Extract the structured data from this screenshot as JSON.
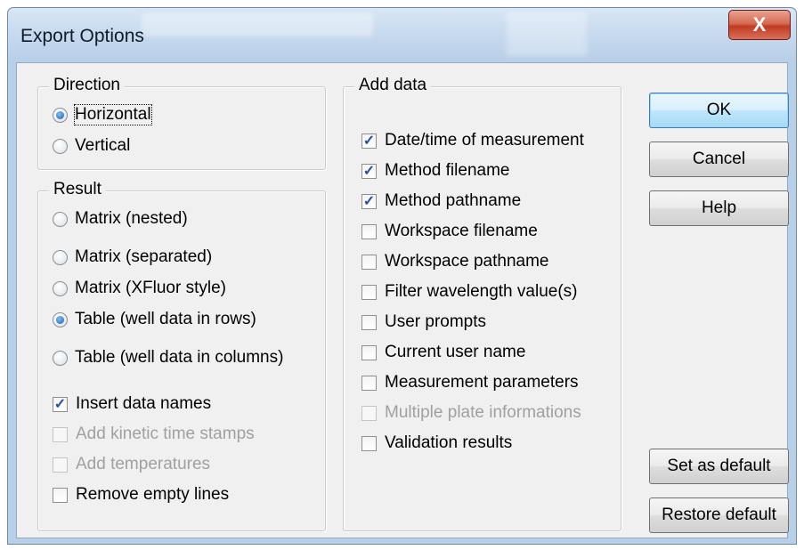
{
  "window": {
    "title": "Export Options",
    "close_label": "X"
  },
  "direction": {
    "legend": "Direction",
    "options": [
      {
        "label": "Horizontal",
        "selected": true
      },
      {
        "label": "Vertical",
        "selected": false
      }
    ]
  },
  "result": {
    "legend": "Result",
    "options": [
      {
        "label": "Matrix (nested)",
        "selected": false
      },
      {
        "label": "Matrix (separated)",
        "selected": false
      },
      {
        "label": "Matrix (XFluor style)",
        "selected": false
      },
      {
        "label": "Table (well data in rows)",
        "selected": true
      },
      {
        "label": "Table (well data in columns)",
        "selected": false
      }
    ],
    "checks": [
      {
        "label": "Insert data names",
        "checked": true,
        "enabled": true
      },
      {
        "label": "Add kinetic time stamps",
        "checked": false,
        "enabled": false
      },
      {
        "label": "Add temperatures",
        "checked": false,
        "enabled": false
      },
      {
        "label": "Remove empty lines",
        "checked": false,
        "enabled": true
      }
    ]
  },
  "add_data": {
    "legend": "Add data",
    "checks": [
      {
        "label": "Date/time of measurement",
        "checked": true,
        "enabled": true
      },
      {
        "label": "Method filename",
        "checked": true,
        "enabled": true
      },
      {
        "label": "Method pathname",
        "checked": true,
        "enabled": true
      },
      {
        "label": "Workspace filename",
        "checked": false,
        "enabled": true
      },
      {
        "label": "Workspace pathname",
        "checked": false,
        "enabled": true
      },
      {
        "label": "Filter wavelength value(s)",
        "checked": false,
        "enabled": true
      },
      {
        "label": "User prompts",
        "checked": false,
        "enabled": true
      },
      {
        "label": "Current user name",
        "checked": false,
        "enabled": true
      },
      {
        "label": "Measurement parameters",
        "checked": false,
        "enabled": true
      },
      {
        "label": "Multiple plate informations",
        "checked": false,
        "enabled": false
      },
      {
        "label": "Validation results",
        "checked": false,
        "enabled": true
      }
    ]
  },
  "buttons": {
    "ok": "OK",
    "cancel": "Cancel",
    "help": "Help",
    "set_default": "Set as default",
    "restore_default": "Restore default"
  }
}
